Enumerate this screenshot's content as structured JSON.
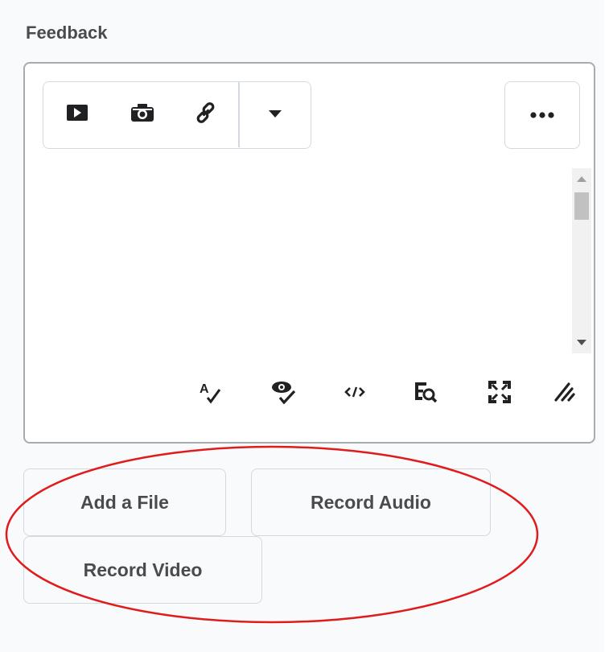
{
  "feedback": {
    "title": "Feedback"
  },
  "editor": {
    "toolbar": {
      "items": [
        {
          "icon": "play-icon",
          "label": "Insert Stuff"
        },
        {
          "icon": "camera-icon",
          "label": "Insert Image"
        },
        {
          "icon": "link-icon",
          "label": "Insert Link"
        },
        {
          "icon": "chevron-down-icon",
          "label": "More Options"
        }
      ],
      "more_icon": "ellipsis-icon"
    },
    "content": "",
    "bottom_tools": [
      {
        "icon": "spellcheck-icon"
      },
      {
        "icon": "accessibility-check-icon"
      },
      {
        "icon": "source-code-icon"
      },
      {
        "icon": "preview-icon"
      },
      {
        "icon": "fullscreen-icon"
      },
      {
        "icon": "resize-handle-icon"
      }
    ]
  },
  "actions": {
    "add_file": "Add a File",
    "record_audio": "Record Audio",
    "record_video": "Record Video"
  },
  "colors": {
    "panel_background": "#f9fafb",
    "border": "#d3d9e3",
    "text": "#494c4e",
    "icon": "#202122",
    "annotation": "#e01b1b"
  }
}
